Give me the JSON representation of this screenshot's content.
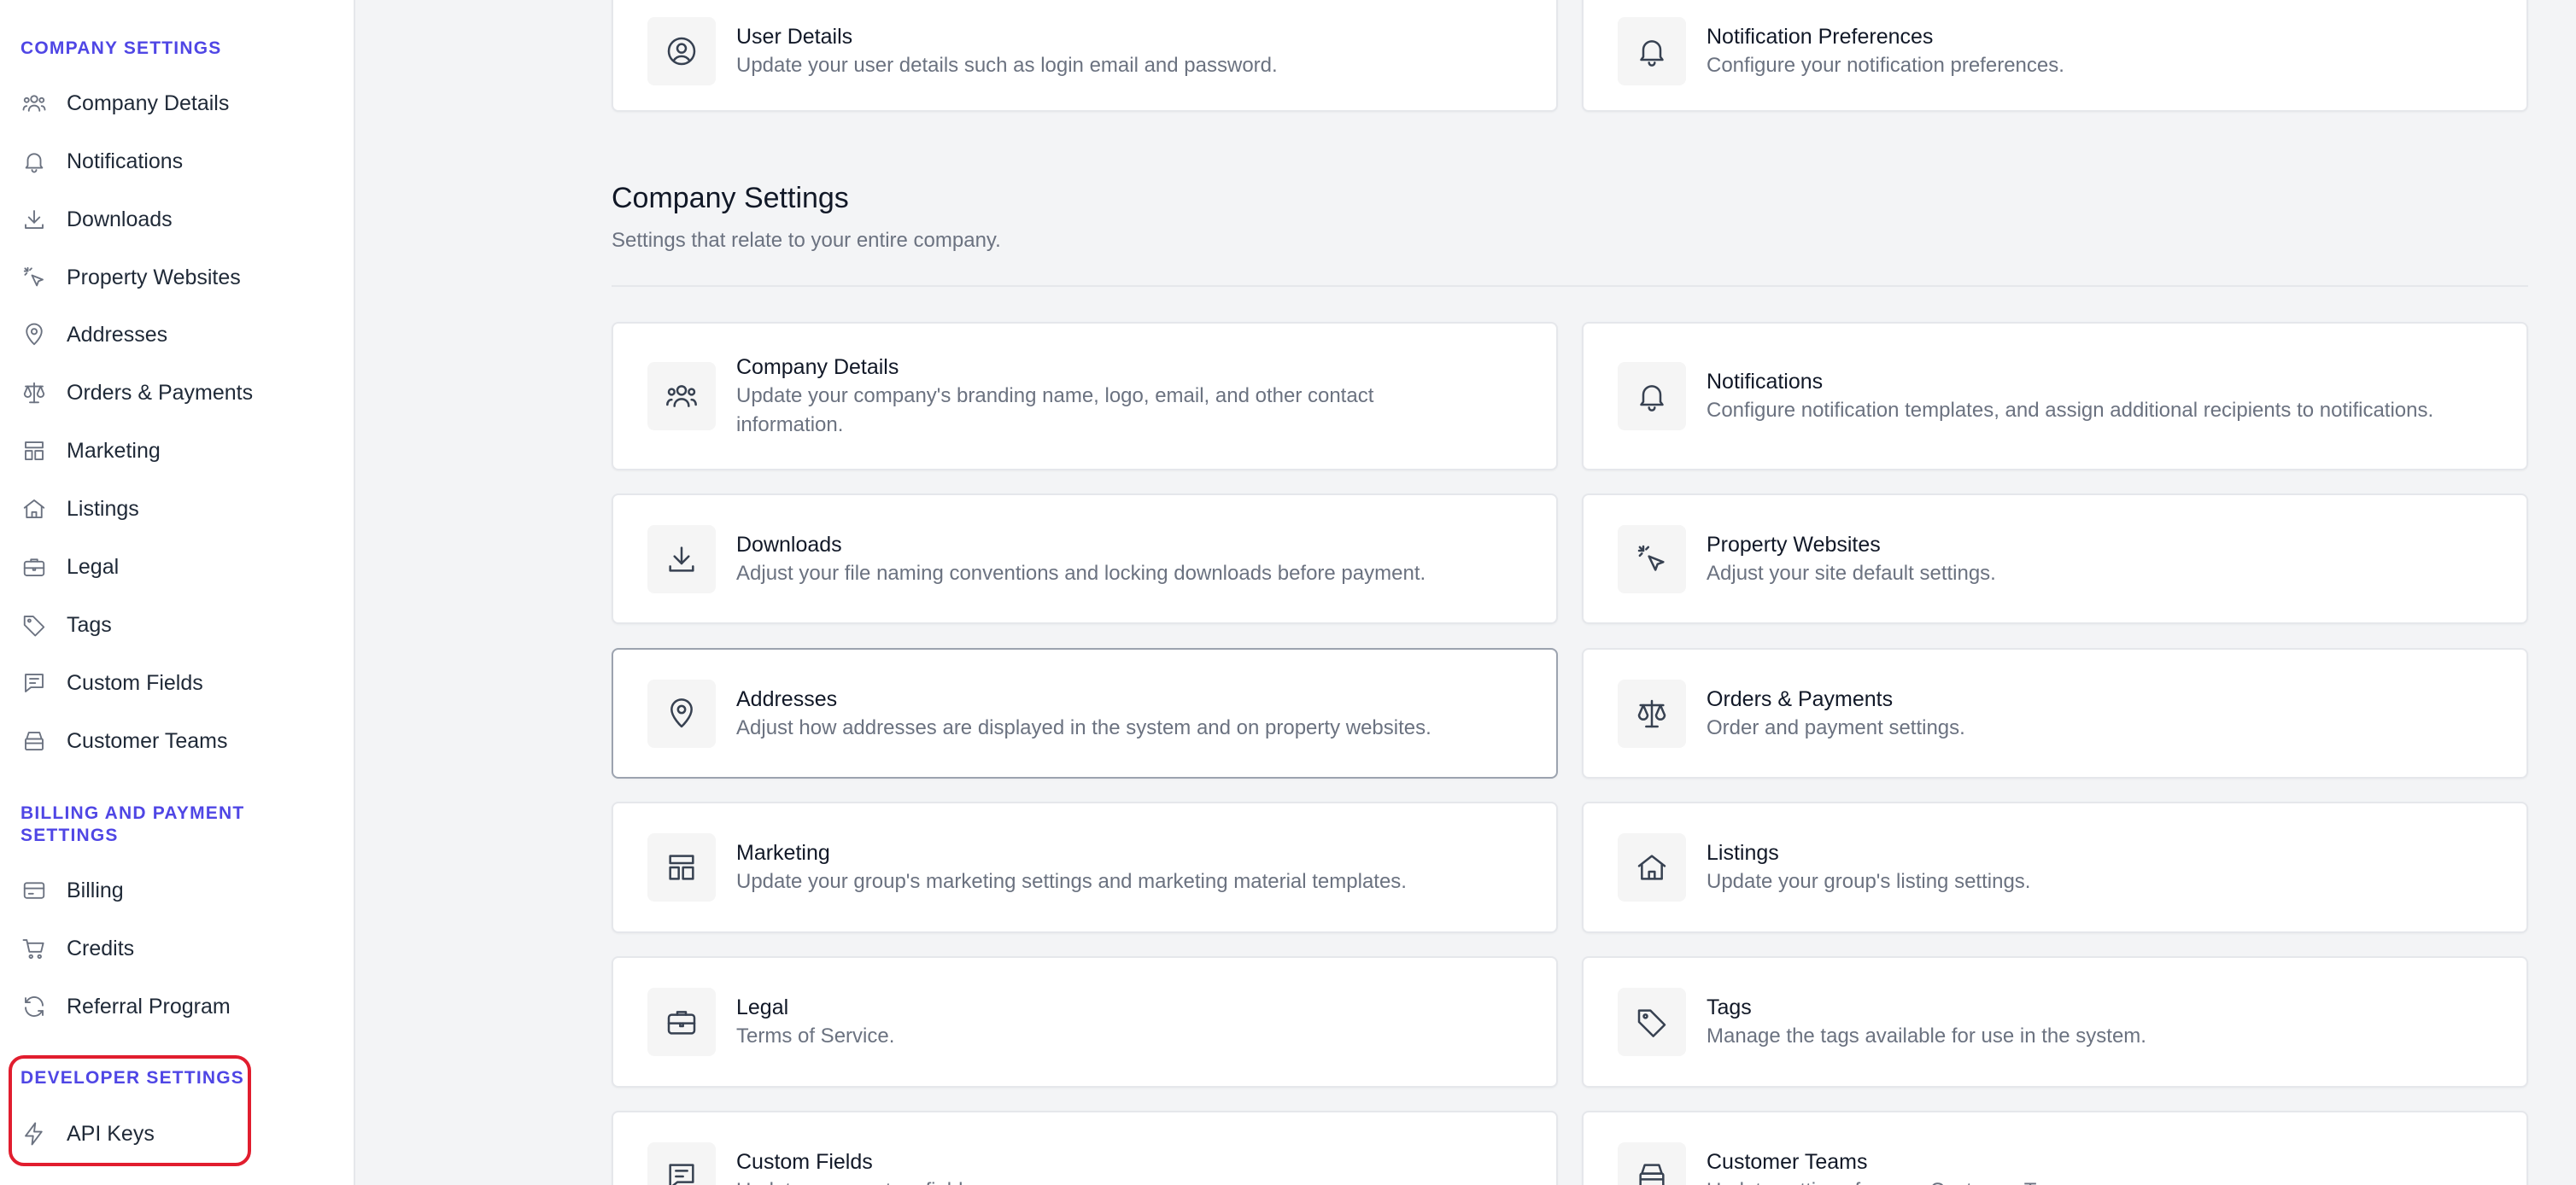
{
  "sidebar": {
    "sections": [
      {
        "title": "Company Settings",
        "items": [
          {
            "label": "Company Details",
            "icon": "users-icon"
          },
          {
            "label": "Notifications",
            "icon": "bell-icon"
          },
          {
            "label": "Downloads",
            "icon": "download-icon"
          },
          {
            "label": "Property Websites",
            "icon": "cursor-click-icon"
          },
          {
            "label": "Addresses",
            "icon": "map-pin-icon"
          },
          {
            "label": "Orders & Payments",
            "icon": "scale-icon"
          },
          {
            "label": "Marketing",
            "icon": "layout-icon"
          },
          {
            "label": "Listings",
            "icon": "home-icon"
          },
          {
            "label": "Legal",
            "icon": "briefcase-icon"
          },
          {
            "label": "Tags",
            "icon": "tag-icon"
          },
          {
            "label": "Custom Fields",
            "icon": "message-square-icon"
          },
          {
            "label": "Customer Teams",
            "icon": "archive-icon"
          }
        ]
      },
      {
        "title": "Billing and Payment Settings",
        "items": [
          {
            "label": "Billing",
            "icon": "credit-card-icon"
          },
          {
            "label": "Credits",
            "icon": "shopping-cart-icon"
          },
          {
            "label": "Referral Program",
            "icon": "refresh-icon"
          }
        ]
      },
      {
        "title": "Developer Settings",
        "items": [
          {
            "label": "API Keys",
            "icon": "lightning-icon"
          }
        ]
      }
    ]
  },
  "user_cards": [
    {
      "title": "User Details",
      "description": "Update your user details such as login email and password.",
      "icon": "user-circle-icon"
    },
    {
      "title": "Notification Preferences",
      "description": "Configure your notification preferences.",
      "icon": "bell-icon"
    }
  ],
  "company_section": {
    "heading": "Company Settings",
    "subheading": "Settings that relate to your entire company."
  },
  "company_cards": [
    {
      "title": "Company Details",
      "description": "Update your company's branding name, logo, email, and other contact information.",
      "icon": "users-icon"
    },
    {
      "title": "Notifications",
      "description": "Configure notification templates, and assign additional recipients to notifications.",
      "icon": "bell-icon"
    },
    {
      "title": "Downloads",
      "description": "Adjust your file naming conventions and locking downloads before payment.",
      "icon": "download-icon"
    },
    {
      "title": "Property Websites",
      "description": "Adjust your site default settings.",
      "icon": "cursor-click-icon"
    },
    {
      "title": "Addresses",
      "description": "Adjust how addresses are displayed in the system and on property websites.",
      "icon": "map-pin-icon"
    },
    {
      "title": "Orders & Payments",
      "description": "Order and payment settings.",
      "icon": "scale-icon"
    },
    {
      "title": "Marketing",
      "description": "Update your group's marketing settings and marketing material templates.",
      "icon": "layout-icon"
    },
    {
      "title": "Listings",
      "description": "Update your group's listing settings.",
      "icon": "home-icon"
    },
    {
      "title": "Legal",
      "description": "Terms of Service.",
      "icon": "briefcase-icon"
    },
    {
      "title": "Tags",
      "description": "Manage the tags available for use in the system.",
      "icon": "tag-icon"
    },
    {
      "title": "Custom Fields",
      "description": "Update your custom fields.",
      "icon": "message-square-icon"
    },
    {
      "title": "Customer Teams",
      "description": "Update settings for your Customer Teams.",
      "icon": "archive-icon"
    }
  ],
  "colors": {
    "accent": "#4f46e5",
    "highlight": "#e11d2e",
    "background": "#f3f4f6"
  }
}
